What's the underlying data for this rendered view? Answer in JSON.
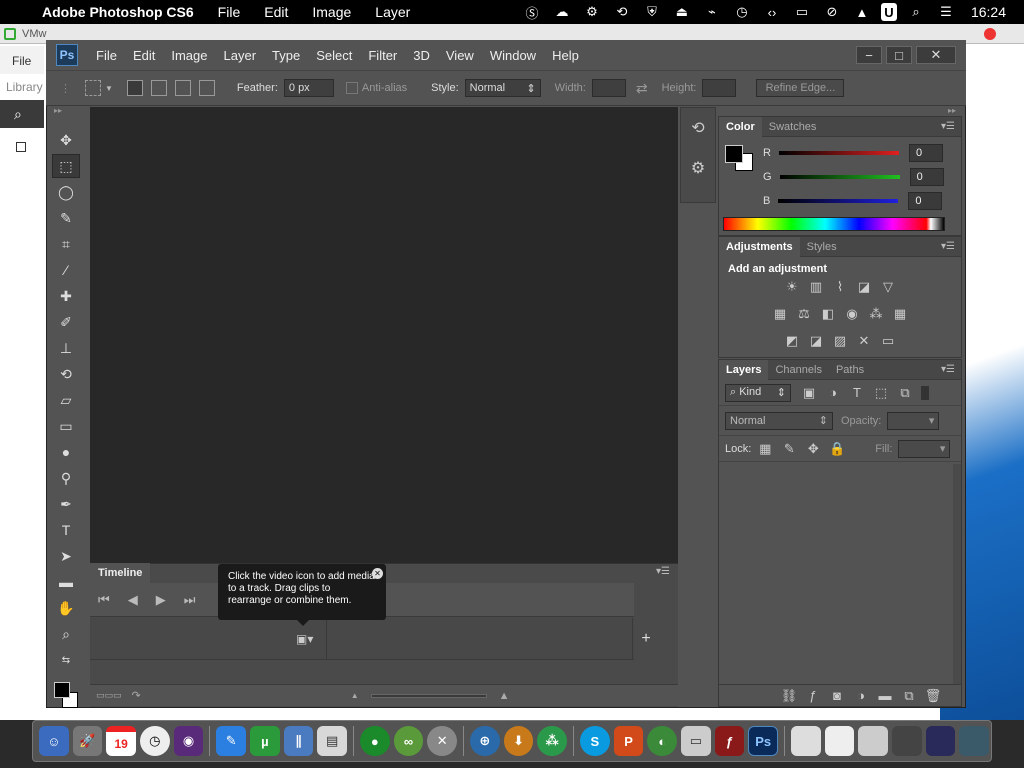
{
  "macbar": {
    "app": "Adobe Photoshop CS6",
    "menus": [
      "File",
      "Edit",
      "Image",
      "Layer"
    ],
    "clock": "16:24",
    "tray_icons": [
      "skype-icon",
      "cloud-icon",
      "antivirus-icon",
      "sync-icon",
      "shield-icon",
      "eject-icon",
      "usb-icon",
      "clock-icon",
      "code-icon",
      "display-icon",
      "wifi-off-icon",
      "upload-icon",
      "user-icon",
      "search-icon",
      "control-center-icon"
    ],
    "user_badge": "U"
  },
  "background_window": {
    "title": "VMw",
    "file_label": "File",
    "library_label": "Library"
  },
  "ps": {
    "logo": "Ps",
    "menus": [
      "File",
      "Edit",
      "Image",
      "Layer",
      "Type",
      "Select",
      "Filter",
      "3D",
      "View",
      "Window",
      "Help"
    ],
    "window_buttons": [
      "minimize",
      "maximize",
      "close"
    ],
    "options": {
      "feather_label": "Feather:",
      "feather_value": "0 px",
      "antialias_label": "Anti-alias",
      "style_label": "Style:",
      "style_value": "Normal",
      "width_label": "Width:",
      "height_label": "Height:",
      "refine_label": "Refine Edge..."
    },
    "tools": [
      "move",
      "rectangular-marquee",
      "lasso",
      "quick-selection",
      "crop",
      "eyedropper",
      "spot-healing",
      "brush",
      "clone-stamp",
      "history-brush",
      "eraser",
      "gradient",
      "blur",
      "dodge",
      "pen",
      "type",
      "path-selection",
      "rectangle",
      "hand",
      "zoom"
    ],
    "timeline": {
      "tab": "Timeline",
      "tooltip": "Click the video icon to add media to a track. Drag clips to rearrange or combine them."
    },
    "color_panel": {
      "tabs": [
        "Color",
        "Swatches"
      ],
      "channels": [
        {
          "label": "R",
          "value": "0",
          "color": "#e02020"
        },
        {
          "label": "G",
          "value": "0",
          "color": "#20c020"
        },
        {
          "label": "B",
          "value": "0",
          "color": "#2020e0"
        }
      ]
    },
    "adjustments_panel": {
      "tabs": [
        "Adjustments",
        "Styles"
      ],
      "heading": "Add an adjustment"
    },
    "layers_panel": {
      "tabs": [
        "Layers",
        "Channels",
        "Paths"
      ],
      "kind_label": "Kind",
      "blend_value": "Normal",
      "opacity_label": "Opacity:",
      "lock_label": "Lock:",
      "fill_label": "Fill:"
    }
  },
  "dock": {
    "calendar_day": "19"
  }
}
